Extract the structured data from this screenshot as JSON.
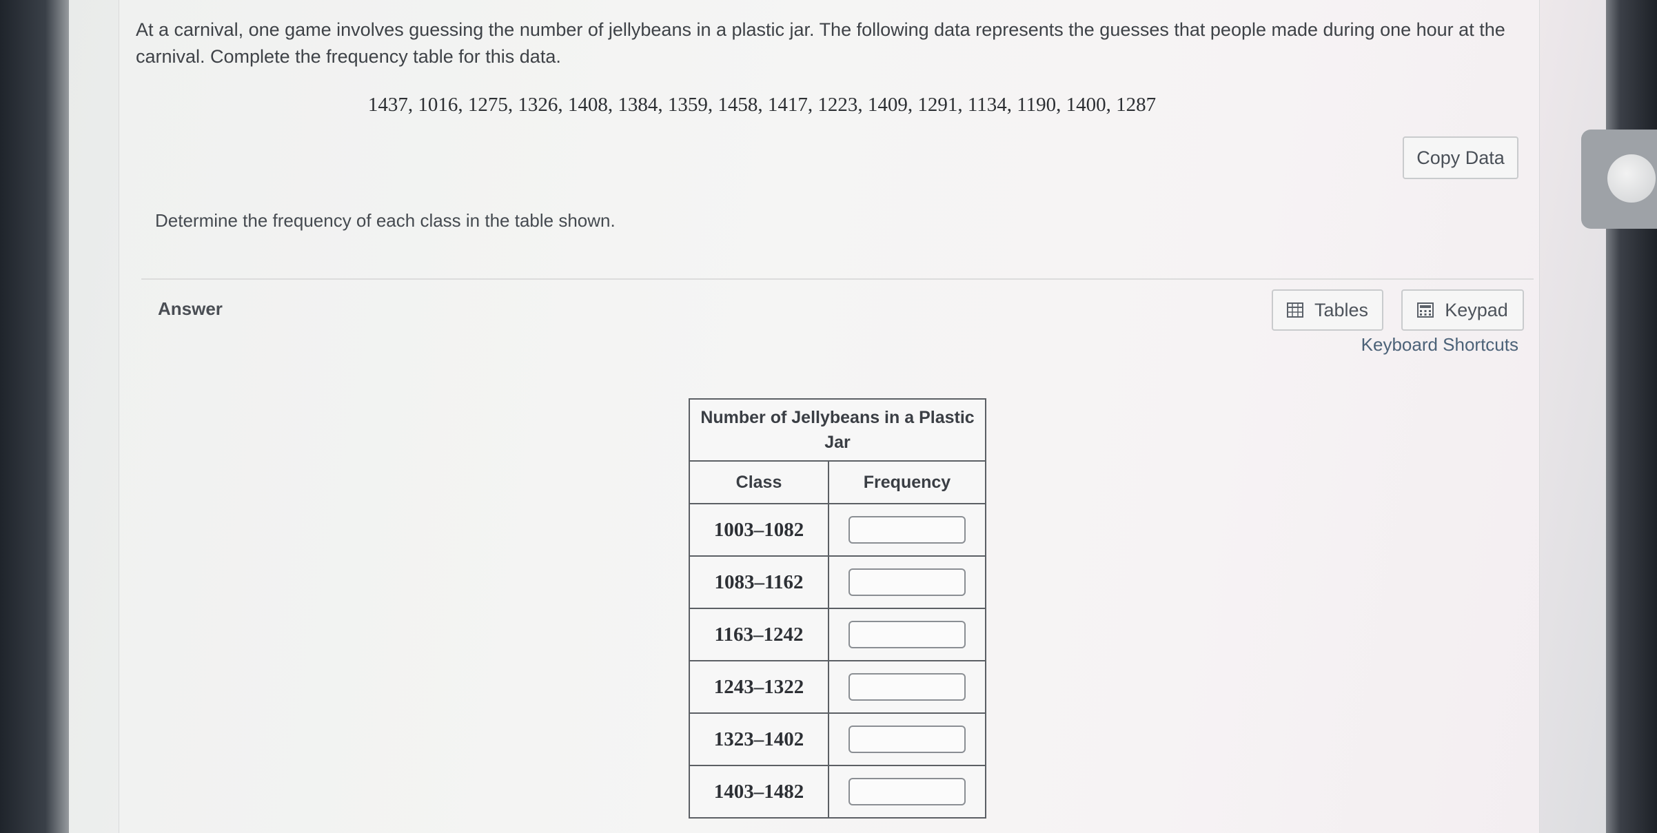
{
  "question": {
    "prompt": "At a carnival, one game involves guessing the number of jellybeans in a plastic jar. The following data represents the guesses that people made during one hour at the carnival. Complete the frequency table for this data.",
    "data_list": "1437, 1016, 1275, 1326, 1408, 1384, 1359, 1458, 1417, 1223, 1409, 1291, 1134, 1190, 1400, 1287",
    "copy_label": "Copy Data",
    "instruction": "Determine the frequency of each class in the table shown."
  },
  "answer": {
    "label": "Answer",
    "tables_label": "Tables",
    "keypad_label": "Keypad",
    "shortcuts_label": "Keyboard Shortcuts"
  },
  "table": {
    "caption": "Number of Jellybeans in a Plastic Jar",
    "col_class": "Class",
    "col_frequency": "Frequency",
    "rows": [
      {
        "class": "1003–1082",
        "frequency": ""
      },
      {
        "class": "1083–1162",
        "frequency": ""
      },
      {
        "class": "1163–1242",
        "frequency": ""
      },
      {
        "class": "1243–1322",
        "frequency": ""
      },
      {
        "class": "1323–1402",
        "frequency": ""
      },
      {
        "class": "1403–1482",
        "frequency": ""
      }
    ]
  },
  "icons": {
    "tables": "table-grid-icon",
    "keypad": "calculator-icon"
  }
}
